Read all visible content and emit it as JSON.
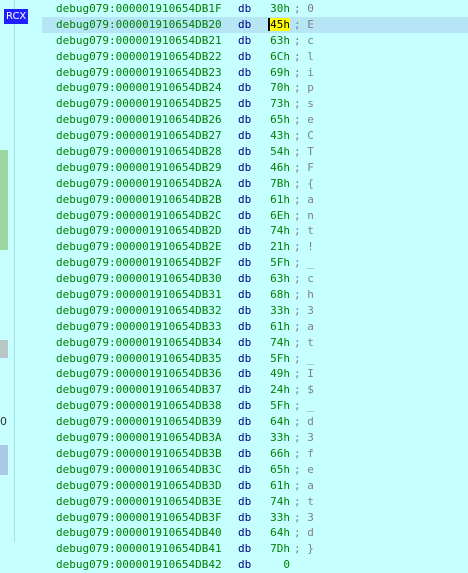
{
  "gutter": {
    "register_label": "RCX",
    "glyph": "0"
  },
  "listing": {
    "mnemonic": "db",
    "rows": [
      {
        "addr": "debug079:000001910654DB1F",
        "val": "30h",
        "cmt": "; 0"
      },
      {
        "addr": "debug079:000001910654DB20",
        "val": "45h",
        "cmt": "; E"
      },
      {
        "addr": "debug079:000001910654DB21",
        "val": "63h",
        "cmt": "; c"
      },
      {
        "addr": "debug079:000001910654DB22",
        "val": "6Ch",
        "cmt": "; l"
      },
      {
        "addr": "debug079:000001910654DB23",
        "val": "69h",
        "cmt": "; i"
      },
      {
        "addr": "debug079:000001910654DB24",
        "val": "70h",
        "cmt": "; p"
      },
      {
        "addr": "debug079:000001910654DB25",
        "val": "73h",
        "cmt": "; s"
      },
      {
        "addr": "debug079:000001910654DB26",
        "val": "65h",
        "cmt": "; e"
      },
      {
        "addr": "debug079:000001910654DB27",
        "val": "43h",
        "cmt": "; C"
      },
      {
        "addr": "debug079:000001910654DB28",
        "val": "54h",
        "cmt": "; T"
      },
      {
        "addr": "debug079:000001910654DB29",
        "val": "46h",
        "cmt": "; F"
      },
      {
        "addr": "debug079:000001910654DB2A",
        "val": "7Bh",
        "cmt": "; {"
      },
      {
        "addr": "debug079:000001910654DB2B",
        "val": "61h",
        "cmt": "; a"
      },
      {
        "addr": "debug079:000001910654DB2C",
        "val": "6Eh",
        "cmt": "; n"
      },
      {
        "addr": "debug079:000001910654DB2D",
        "val": "74h",
        "cmt": "; t"
      },
      {
        "addr": "debug079:000001910654DB2E",
        "val": "21h",
        "cmt": "; !"
      },
      {
        "addr": "debug079:000001910654DB2F",
        "val": "5Fh",
        "cmt": "; _"
      },
      {
        "addr": "debug079:000001910654DB30",
        "val": "63h",
        "cmt": "; c"
      },
      {
        "addr": "debug079:000001910654DB31",
        "val": "68h",
        "cmt": "; h"
      },
      {
        "addr": "debug079:000001910654DB32",
        "val": "33h",
        "cmt": "; 3"
      },
      {
        "addr": "debug079:000001910654DB33",
        "val": "61h",
        "cmt": "; a"
      },
      {
        "addr": "debug079:000001910654DB34",
        "val": "74h",
        "cmt": "; t"
      },
      {
        "addr": "debug079:000001910654DB35",
        "val": "5Fh",
        "cmt": "; _"
      },
      {
        "addr": "debug079:000001910654DB36",
        "val": "49h",
        "cmt": "; I"
      },
      {
        "addr": "debug079:000001910654DB37",
        "val": "24h",
        "cmt": "; $"
      },
      {
        "addr": "debug079:000001910654DB38",
        "val": "5Fh",
        "cmt": "; _"
      },
      {
        "addr": "debug079:000001910654DB39",
        "val": "64h",
        "cmt": "; d"
      },
      {
        "addr": "debug079:000001910654DB3A",
        "val": "33h",
        "cmt": "; 3"
      },
      {
        "addr": "debug079:000001910654DB3B",
        "val": "66h",
        "cmt": "; f"
      },
      {
        "addr": "debug079:000001910654DB3C",
        "val": "65h",
        "cmt": "; e"
      },
      {
        "addr": "debug079:000001910654DB3D",
        "val": "61h",
        "cmt": "; a"
      },
      {
        "addr": "debug079:000001910654DB3E",
        "val": "74h",
        "cmt": "; t"
      },
      {
        "addr": "debug079:000001910654DB3F",
        "val": "33h",
        "cmt": "; 3"
      },
      {
        "addr": "debug079:000001910654DB40",
        "val": "64h",
        "cmt": "; d"
      },
      {
        "addr": "debug079:000001910654DB41",
        "val": "7Dh",
        "cmt": "; }"
      },
      {
        "addr": "debug079:000001910654DB42",
        "val": "0",
        "cmt": ""
      }
    ],
    "highlighted_row": 1
  },
  "colors": {
    "background": "#c5ffff",
    "address": "#008000",
    "mnemonic": "#000080",
    "comment": "#808080",
    "highlight": "#b6e6f5",
    "cursor": "#ffff00",
    "register_badge": "#2020ff"
  }
}
